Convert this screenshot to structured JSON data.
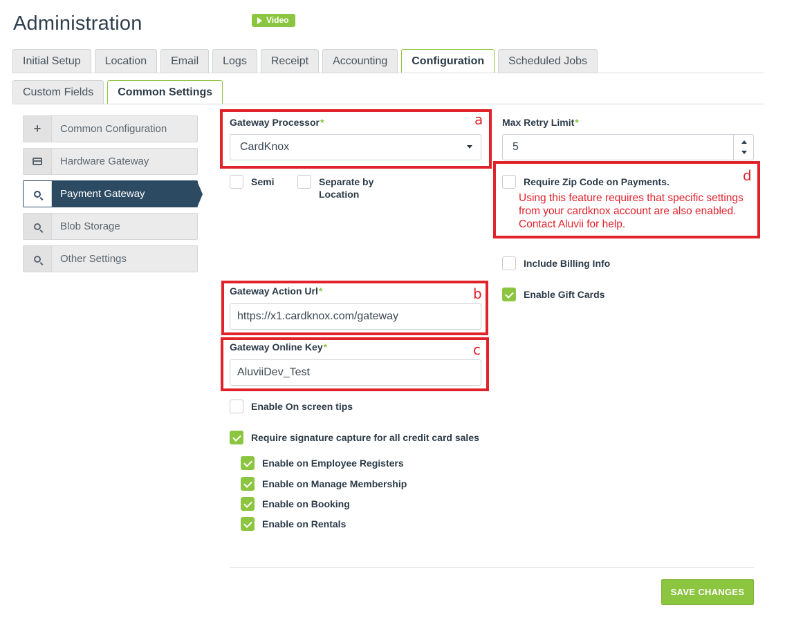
{
  "header": {
    "title": "Administration",
    "video_label": "Video"
  },
  "tabs": {
    "primary": [
      "Initial Setup",
      "Location",
      "Email",
      "Logs",
      "Receipt",
      "Accounting",
      "Configuration",
      "Scheduled Jobs"
    ],
    "primary_active": "Configuration",
    "secondary": [
      "Custom Fields",
      "Common Settings"
    ],
    "secondary_active": "Common Settings"
  },
  "sidebar": {
    "items": [
      {
        "label": "Common Configuration",
        "icon": "plus-icon"
      },
      {
        "label": "Hardware Gateway",
        "icon": "card-icon"
      },
      {
        "label": "Payment Gateway",
        "icon": "search-icon",
        "active": true
      },
      {
        "label": "Blob Storage",
        "icon": "search-icon"
      },
      {
        "label": "Other Settings",
        "icon": "search-icon"
      }
    ]
  },
  "form": {
    "gateway_processor": {
      "label": "Gateway Processor",
      "required_mark": "*",
      "value": "CardKnox"
    },
    "max_retry": {
      "label": "Max Retry Limit",
      "required_mark": "*",
      "value": "5"
    },
    "semi": {
      "label": "Semi",
      "checked": false
    },
    "separate_by_location": {
      "label": "Separate by Location",
      "checked": false
    },
    "require_zip": {
      "label": "Require Zip Code on Payments.",
      "checked": false
    },
    "zip_warning": "Using this feature requires that specific settings from your cardknox account are also enabled. Contact Aluvii for help.",
    "include_billing": {
      "label": "Include Billing Info",
      "checked": false
    },
    "enable_gift_cards": {
      "label": "Enable Gift Cards",
      "checked": true
    },
    "gateway_action_url": {
      "label": "Gateway Action Url",
      "required_mark": "*",
      "value": "https://x1.cardknox.com/gateway"
    },
    "gateway_online_key": {
      "label": "Gateway Online Key",
      "required_mark": "*",
      "value": "AluviiDev_Test"
    },
    "enable_onscreen_tips": {
      "label": "Enable On screen tips",
      "checked": false
    },
    "require_signature": {
      "label": "Require signature capture for all credit card sales",
      "checked": true
    },
    "signature_options": [
      {
        "label": "Enable on Employee Registers",
        "checked": true
      },
      {
        "label": "Enable on Manage Membership",
        "checked": true
      },
      {
        "label": "Enable on Booking",
        "checked": true
      },
      {
        "label": "Enable on Rentals",
        "checked": true
      }
    ],
    "save_label": "SAVE CHANGES"
  },
  "annotations": {
    "a": "a",
    "b": "b",
    "c": "c",
    "d": "d"
  },
  "colors": {
    "accent": "#8cc540",
    "nav_active": "#2d4a63",
    "highlight": "#e0222b"
  }
}
